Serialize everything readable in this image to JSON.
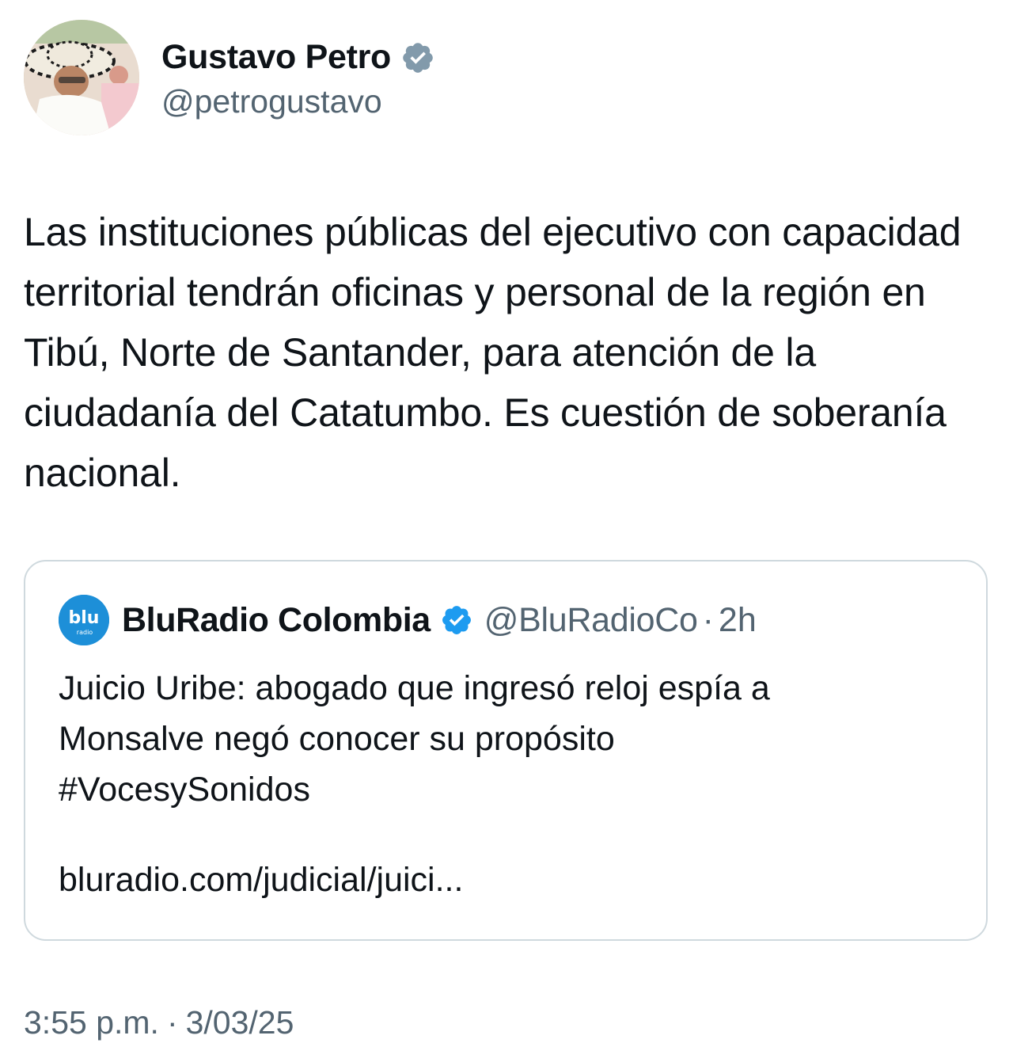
{
  "author": {
    "display_name": "Gustavo Petro",
    "handle": "@petrogustavo",
    "verified_badge": "gray-verified-icon",
    "avatar": "avatar-image"
  },
  "tweet": {
    "text": "Las instituciones públicas del ejecutivo con capacidad territorial tendrán oficinas y personal de la región en Tibú, Norte de Santander, para atención de la ciudadanía del Catatumbo. Es cuestión de soberanía nacional."
  },
  "quoted_tweet": {
    "logo": "bluradio-logo",
    "display_name": "BluRadio Colombia",
    "verified_badge": "blue-verified-icon",
    "handle": "@BluRadioCo",
    "separator": "·",
    "time": "2h",
    "text_lines": [
      "Juicio Uribe: abogado que ingresó reloj espía a",
      "Monsalve negó conocer su propósito",
      "#VocesySonidos"
    ],
    "link": "bluradio.com/judicial/juici..."
  },
  "footer": {
    "time": "3:55 p.m.",
    "separator": "·",
    "date": "3/03/25"
  },
  "colors": {
    "text_primary": "#0f1419",
    "text_secondary": "#536471",
    "border": "#cfd9de",
    "verified_blue": "#1d9bf0",
    "verified_gray": "#829aab"
  }
}
